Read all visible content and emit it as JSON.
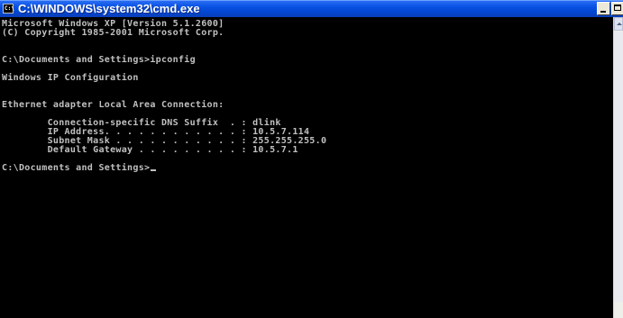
{
  "window": {
    "title": "C:\\WINDOWS\\system32\\cmd.exe",
    "icon": "console-app-icon",
    "icon_text": "C:\\"
  },
  "console": {
    "lines": [
      "Microsoft Windows XP [Version 5.1.2600]",
      "(C) Copyright 1985-2001 Microsoft Corp.",
      "",
      "",
      "C:\\Documents and Settings>ipconfig",
      "",
      "Windows IP Configuration",
      "",
      "",
      "Ethernet adapter Local Area Connection:",
      "",
      "        Connection-specific DNS Suffix  . : dlink",
      "        IP Address. . . . . . . . . . . . : 10.5.7.114",
      "        Subnet Mask . . . . . . . . . . . : 255.255.255.0",
      "        Default Gateway . . . . . . . . . : 10.5.7.1",
      "",
      "C:\\Documents and Settings>"
    ],
    "text_color": "#c0c0c0",
    "background_color": "#000000"
  }
}
